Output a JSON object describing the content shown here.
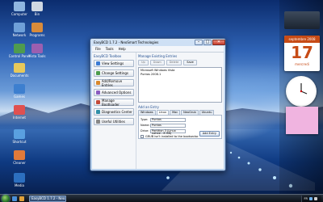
{
  "desktop": {
    "icons": [
      {
        "label": "Computer",
        "color": "#8fb6e0"
      },
      {
        "label": "Bin",
        "color": "#cfd8e3"
      },
      {
        "label": "Network",
        "color": "#6fa0d8"
      },
      {
        "label": "Programs",
        "color": "#d98b3a"
      },
      {
        "label": "Control Panel",
        "color": "#4f9b4f"
      },
      {
        "label": "Vista Tools",
        "color": "#9b5fb0"
      },
      {
        "label": "Documents",
        "color": "#e8c95a"
      },
      {
        "label": "Games",
        "color": "#3d7fcf"
      },
      {
        "label": "Internet",
        "color": "#e05050"
      },
      {
        "label": "Shortcut",
        "color": "#5aa0e0"
      },
      {
        "label": "Cleaner",
        "color": "#e07a3a"
      },
      {
        "label": "Media",
        "color": "#2c6fbf"
      }
    ]
  },
  "sidebar": {
    "top_label": "",
    "calendar": {
      "month": "septembre 2008",
      "day": "17",
      "weekday": "mercredi"
    }
  },
  "window": {
    "title": "EasyBCD 1.7.2 - NeoSmart Technologies",
    "menu": [
      "File",
      "Tools",
      "Help"
    ],
    "left_header": "EasyBCD Toolbox",
    "nav": [
      {
        "label": "View Settings",
        "icon_color": "#3b7bd4"
      },
      {
        "label": "Change Settings",
        "icon_color": "#4c9c4c"
      },
      {
        "label": "Add/Remove Entries",
        "icon_color": "#d9882c"
      },
      {
        "label": "Advanced Options",
        "icon_color": "#8a5cc0"
      },
      {
        "label": "Manage Bootloader",
        "icon_color": "#c44a3a"
      },
      {
        "label": "Diagnostics Center",
        "icon_color": "#2f8fa8"
      },
      {
        "label": "Useful Utilities",
        "icon_color": "#888888"
      }
    ],
    "manage_title": "Manage Existing Entries",
    "tools": {
      "up": "Up",
      "down": "Down",
      "delete": "Delete",
      "save": "Save"
    },
    "entries": [
      "Microsoft Windows Vista",
      "Puntos 2008.1"
    ],
    "add_title": "Add an Entry",
    "tabs": [
      "Windows",
      "Linux",
      "Mac",
      "NeoGrub",
      "Ubuntu"
    ],
    "active_tab_index": 1,
    "type_label": "Type:",
    "type_value": "Puntos",
    "name_label": "Name:",
    "name_value": "Puntos",
    "drive_label": "Drive:",
    "drive_value": "Partition 3 (Linux native - 8 GB)",
    "grub_checkbox": "GRUB isn't installed to the bootsector",
    "add_button": "Add Entry"
  },
  "taskbar": {
    "task_label": "EasyBCD 1.7.2 - Neo...",
    "tray_lang": "FR",
    "tray_time": ""
  }
}
